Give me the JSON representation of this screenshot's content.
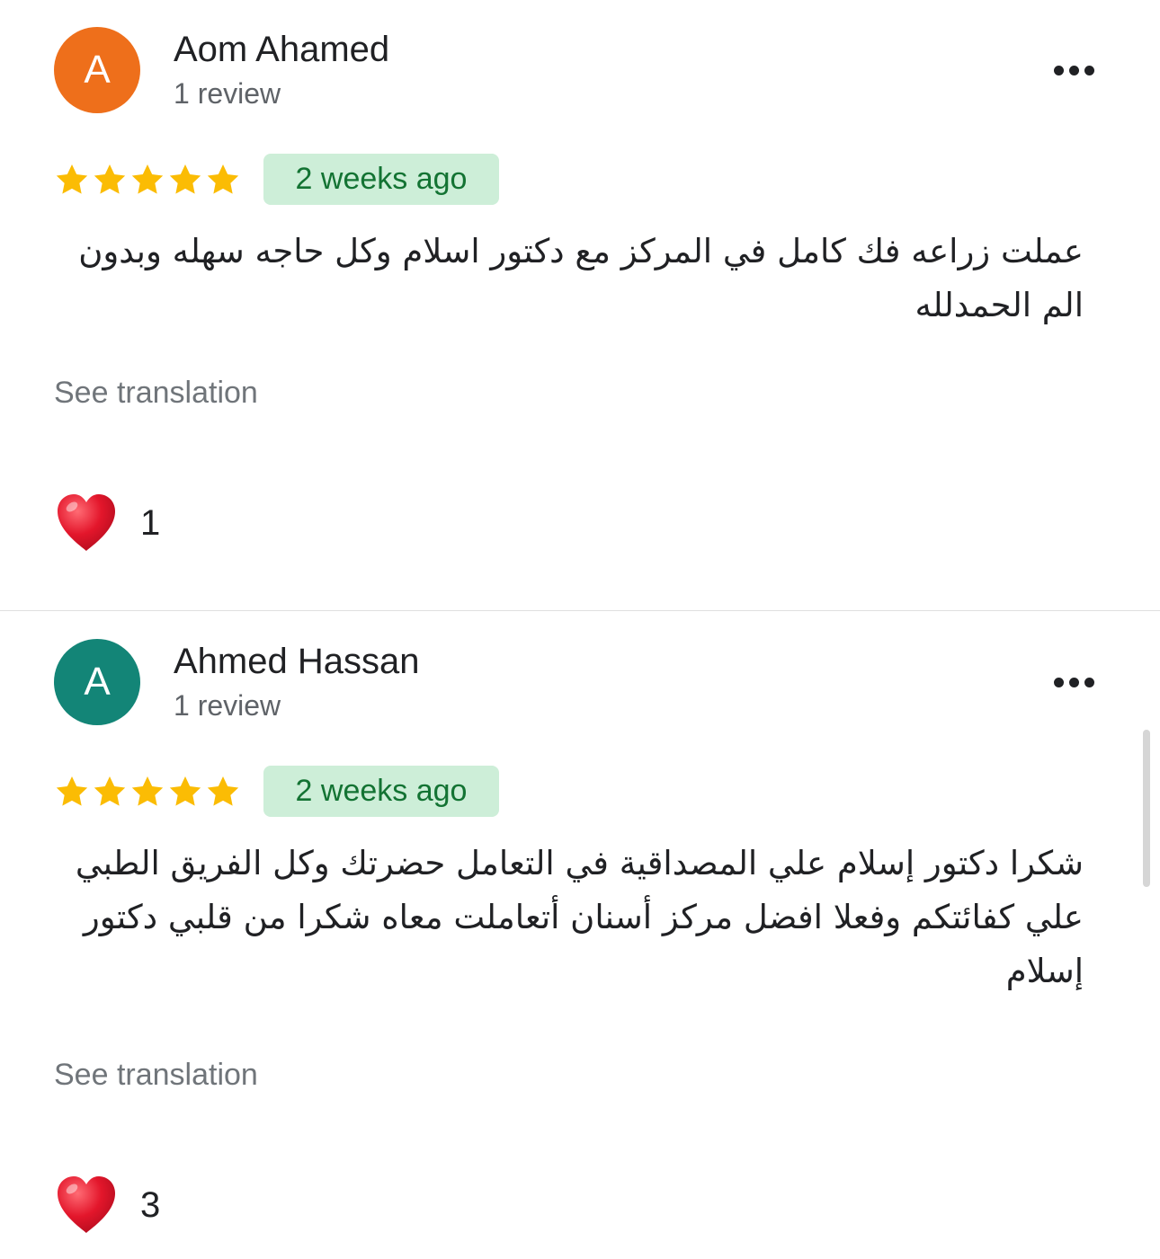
{
  "colors": {
    "avatar_orange": "#ee6f1b",
    "avatar_teal": "#138577",
    "star": "#fbbc04",
    "badge_bg": "#cdeed8",
    "badge_text": "#137333",
    "heart": "#e3162b"
  },
  "reviews": [
    {
      "avatar_initial": "A",
      "avatar_color": "#ee6f1b",
      "author": "Aom Ahamed",
      "review_count": "1 review",
      "rating": 5,
      "time": "2 weeks ago",
      "text": "عملت زراعه فك كامل في المركز مع دكتور اسلام وكل حاجه سهله وبدون الم الحمدلله",
      "see_translation": "See translation",
      "reaction_icon": "heart-icon",
      "reaction_count": "1",
      "more_icon": "more-options-icon"
    },
    {
      "avatar_initial": "A",
      "avatar_color": "#138577",
      "author": "Ahmed Hassan",
      "review_count": "1 review",
      "rating": 5,
      "time": "2 weeks ago",
      "text": "شكرا دكتور إسلام علي المصداقية في التعامل حضرتك وكل الفريق الطبي علي كفائتكم وفعلا افضل مركز أسنان أتعاملت معاه شكرا من قلبي دكتور إسلام",
      "see_translation": "See translation",
      "reaction_icon": "heart-icon",
      "reaction_count": "3",
      "more_icon": "more-options-icon"
    }
  ]
}
